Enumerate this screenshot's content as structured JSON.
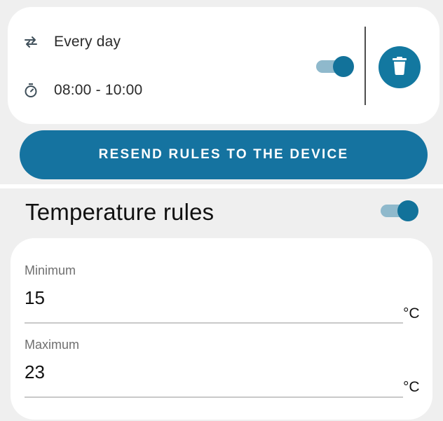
{
  "rule": {
    "repeat_text": "Every day",
    "time_text": "08:00 - 10:00",
    "enabled": true,
    "icons": {
      "repeat": "repeat-icon",
      "time": "timer-icon",
      "delete": "trash-icon"
    }
  },
  "actions": {
    "resend_label": "RESEND RULES TO THE DEVICE"
  },
  "temperature": {
    "title": "Temperature rules",
    "enabled": true,
    "minimum": {
      "label": "Minimum",
      "value": "15",
      "unit": "°C"
    },
    "maximum": {
      "label": "Maximum",
      "value": "23",
      "unit": "°C"
    }
  },
  "colors": {
    "accent": "#1573a0",
    "toggle_track": "#8fb9cc",
    "card": "#ffffff",
    "background": "#efefef"
  }
}
